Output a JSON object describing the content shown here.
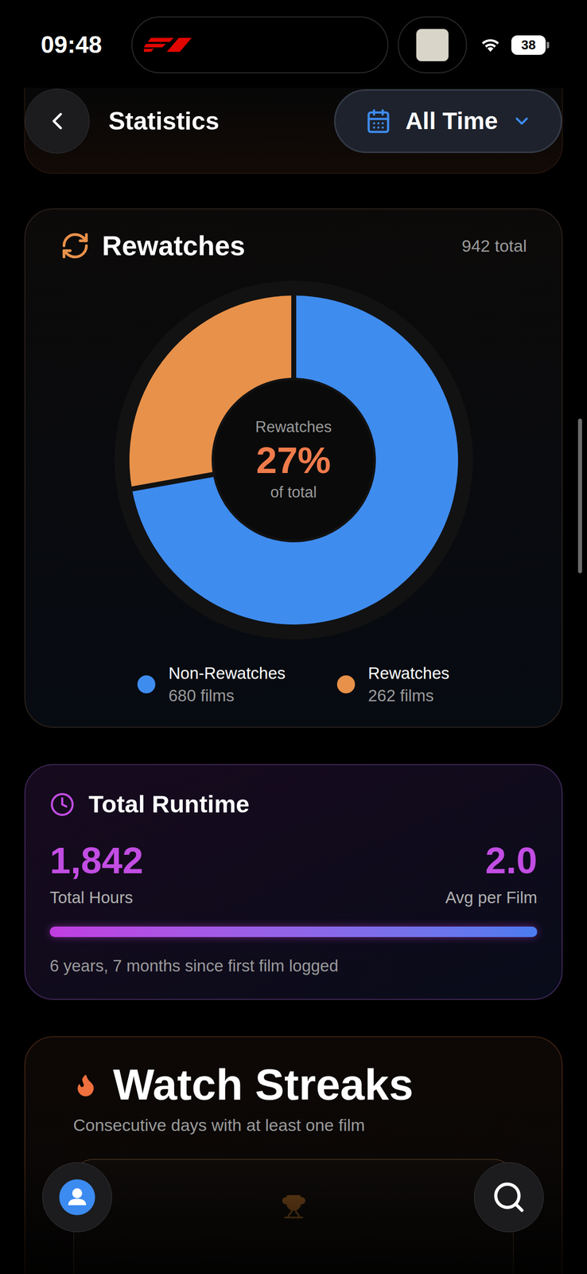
{
  "status_bar": {
    "time": "09:48",
    "battery": "38"
  },
  "header": {
    "title": "Statistics",
    "range": "All Time"
  },
  "rewatches": {
    "title": "Rewatches",
    "total": "942 total",
    "center": {
      "label": "Rewatches",
      "value": "27%",
      "caption": "of total"
    },
    "series": [
      {
        "label": "Non-Rewatches",
        "count": "680 films",
        "value": 680,
        "color": "#3f8cef"
      },
      {
        "label": "Rewatches",
        "count": "262 films",
        "value": 262,
        "color": "#e8914a"
      }
    ]
  },
  "runtime": {
    "title": "Total Runtime",
    "hours": "1,842",
    "hours_label": "Total Hours",
    "avg": "2.0",
    "avg_label": "Avg per Film",
    "level": 1,
    "footer": "6 years, 7 months since first film logged"
  },
  "streaks": {
    "title": "Watch Streaks",
    "subtitle": "Consecutive days with at least one film"
  }
}
